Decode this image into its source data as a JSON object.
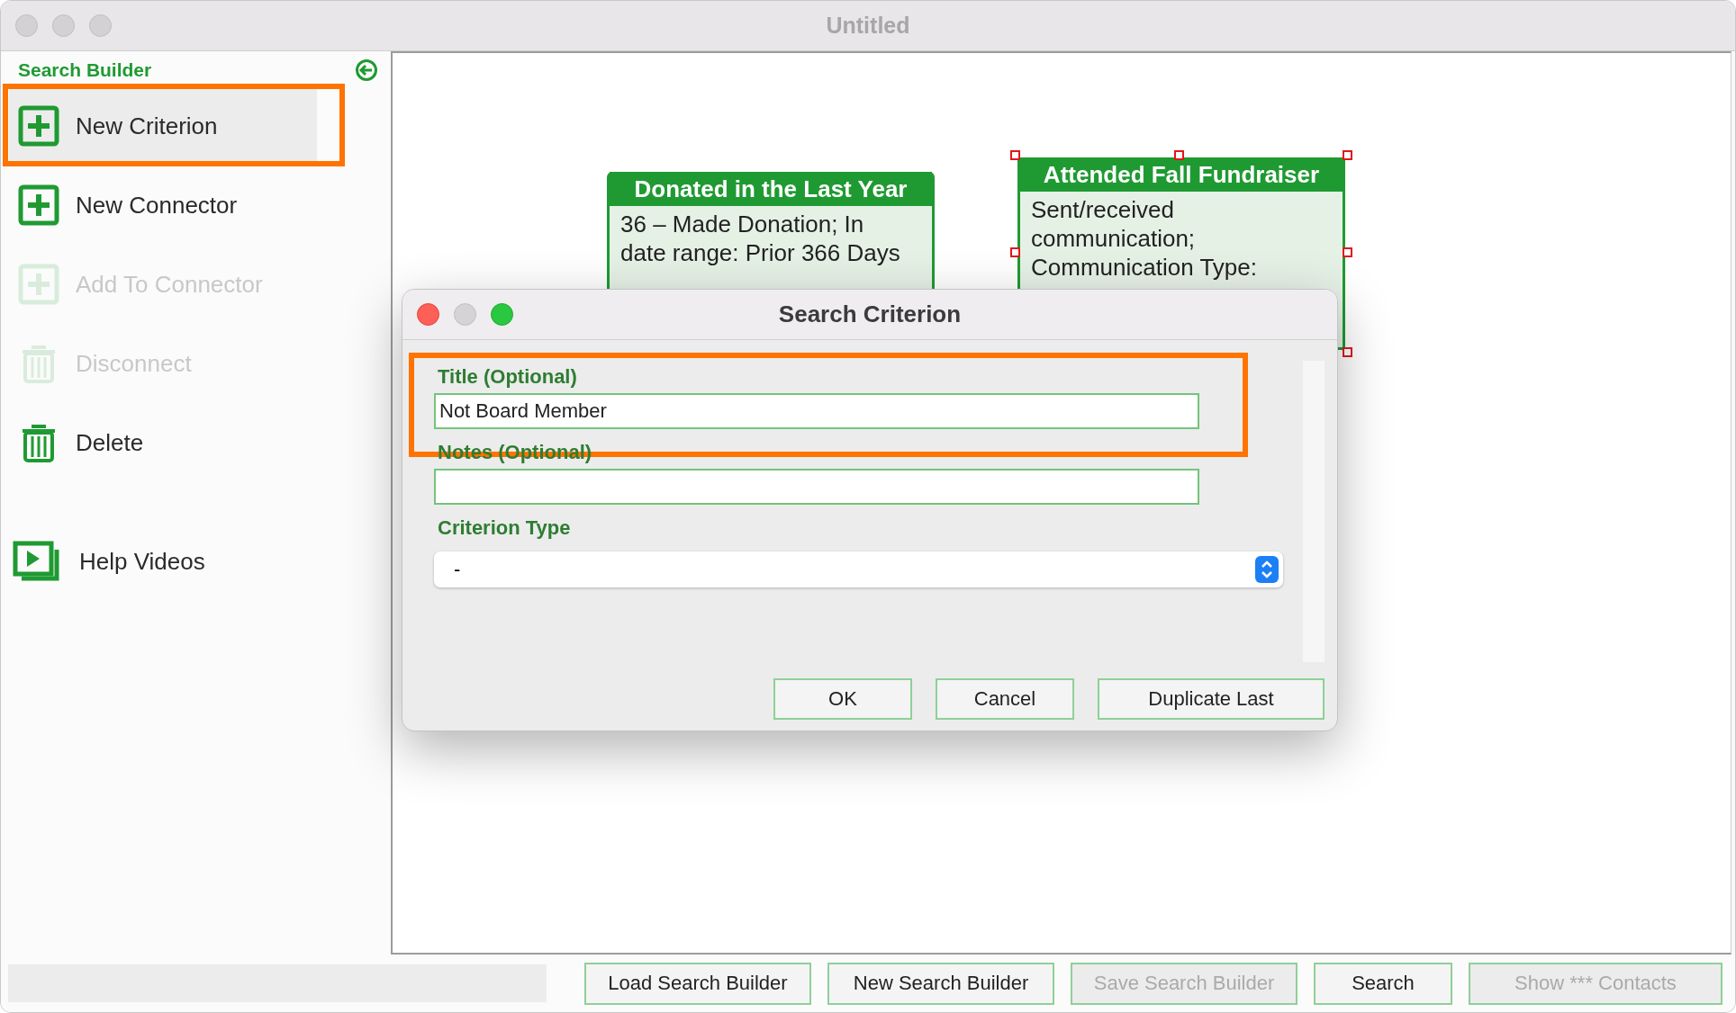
{
  "window": {
    "title": "Untitled"
  },
  "sidebar": {
    "title": "Search Builder",
    "items": [
      {
        "label": "New Criterion",
        "kind": "plus",
        "selected": true,
        "disabled": false,
        "highlighted": true
      },
      {
        "label": "New Connector",
        "kind": "plus",
        "selected": false,
        "disabled": false,
        "highlighted": false
      },
      {
        "label": "Add To Connector",
        "kind": "plus",
        "selected": false,
        "disabled": true,
        "highlighted": false
      },
      {
        "label": "Disconnect",
        "kind": "trash",
        "selected": false,
        "disabled": true,
        "highlighted": false
      },
      {
        "label": "Delete",
        "kind": "trash",
        "selected": false,
        "disabled": false,
        "highlighted": false
      },
      {
        "label": "Help Videos",
        "kind": "video",
        "selected": false,
        "disabled": false,
        "highlighted": false
      }
    ]
  },
  "canvas": {
    "nodes": [
      {
        "title": "Donated in the Last Year",
        "body": "36 – Made Donation; In date range: Prior 366 Days",
        "selected": false
      },
      {
        "title": "Attended Fall Fundraiser",
        "body": "Sent/received communication; Communication Type:",
        "selected": true
      }
    ]
  },
  "dialog": {
    "title": "Search Criterion",
    "fields": [
      {
        "kind": "text",
        "label": "Title (Optional)",
        "value": "Not Board Member",
        "highlighted": true
      },
      {
        "kind": "text",
        "label": "Notes (Optional)",
        "highlighted": false
      },
      {
        "kind": "select",
        "label": "Criterion Type",
        "value": "-",
        "highlighted": false
      }
    ],
    "buttons": [
      "OK",
      "Cancel",
      "Duplicate Last"
    ]
  },
  "toolbar": {
    "buttons": [
      {
        "label": "Load Search Builder",
        "disabled": false
      },
      {
        "label": "New Search Builder",
        "disabled": false
      },
      {
        "label": "Save Search Builder",
        "disabled": true
      },
      {
        "label": "Search",
        "disabled": false
      },
      {
        "label": "Show *** Contacts",
        "disabled": true
      }
    ]
  }
}
